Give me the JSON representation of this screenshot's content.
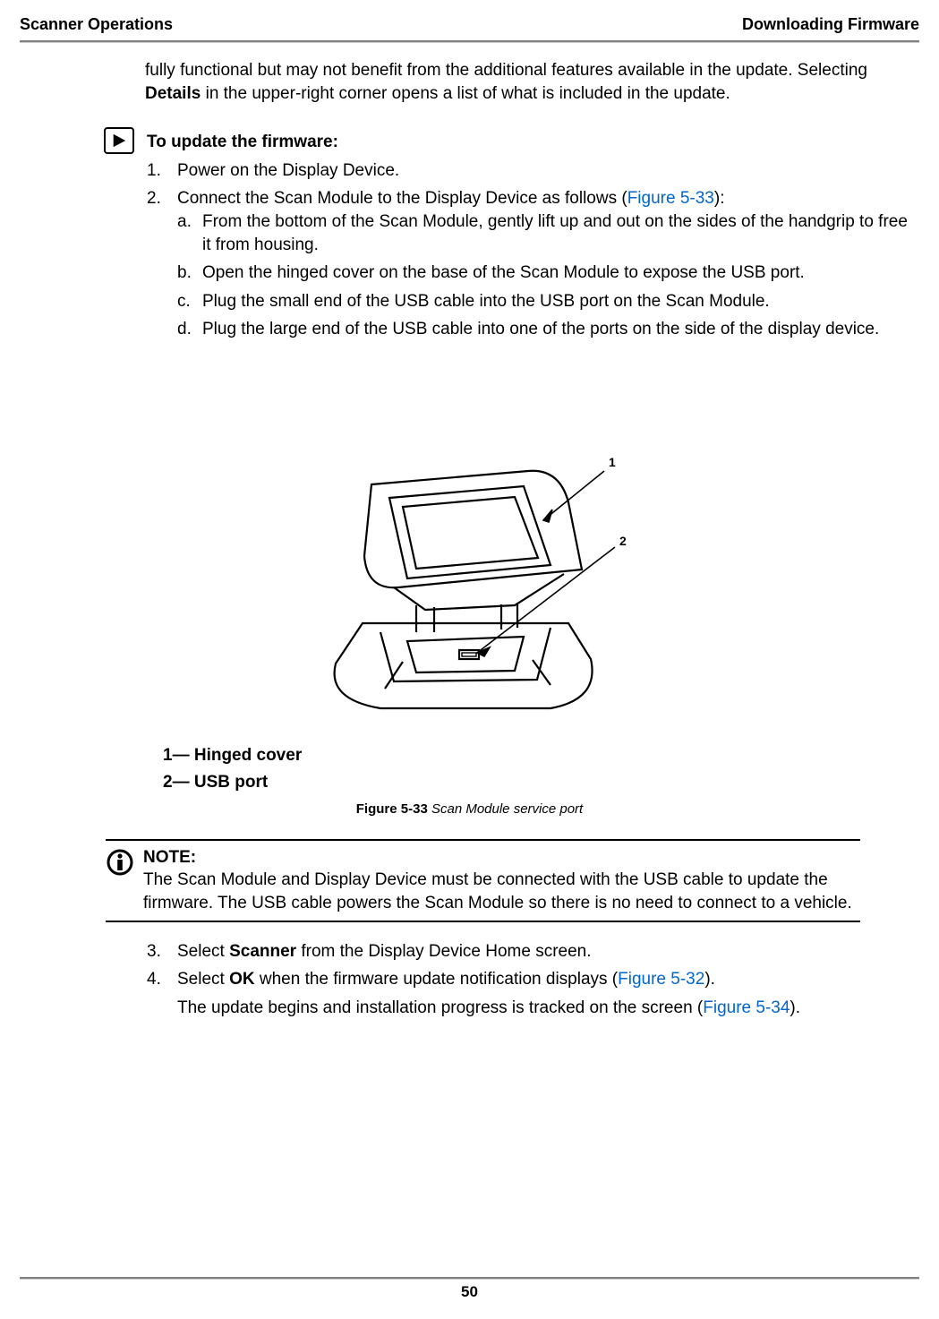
{
  "header": {
    "left": "Scanner Operations",
    "right": "Downloading Firmware"
  },
  "intro": {
    "text_pre": "fully functional but may not benefit from the additional features available in the update. Selecting ",
    "bold": "Details",
    "text_post": " in the upper-right corner opens a list of what is included in the update."
  },
  "procedure": {
    "title": "To update the firmware:",
    "step1": "Power on the Display Device.",
    "step2_pre": "Connect the Scan Module to the Display Device as follows (",
    "step2_link": "Figure 5-33",
    "step2_post": "):",
    "sub_a": "From the bottom of the Scan Module, gently lift up and out on the sides of the handgrip to free it from housing.",
    "sub_b": "Open the hinged cover on the base of the Scan Module to expose the USB port.",
    "sub_c": "Plug the small end of the USB cable into the USB port on the Scan Module.",
    "sub_d": "Plug the large end of the USB cable into one of the ports on the side of the display device."
  },
  "figure": {
    "callout1": "1",
    "callout2": "2",
    "legend1": "1— Hinged cover",
    "legend2": "2— USB port",
    "caption_bold": "Figure 5-33 ",
    "caption_italic": "Scan Module service port"
  },
  "note": {
    "label": "NOTE:",
    "text": "The Scan Module and Display Device must be connected with the USB cable to update the firmware. The USB cable powers the Scan Module so there is no need to connect to a vehicle."
  },
  "steps_cont": {
    "step3_marker": "3.",
    "step3_pre": "Select ",
    "step3_bold": "Scanner",
    "step3_post": " from the Display Device Home screen.",
    "step4_marker": "4.",
    "step4_pre": "Select ",
    "step4_bold": "OK",
    "step4_mid": " when the firmware update notification displays (",
    "step4_link": "Figure 5-32",
    "step4_post": ").",
    "after_pre": "The update begins and installation progress is tracked on the screen (",
    "after_link": "Figure 5-34",
    "after_post": ")."
  },
  "page_number": "50"
}
